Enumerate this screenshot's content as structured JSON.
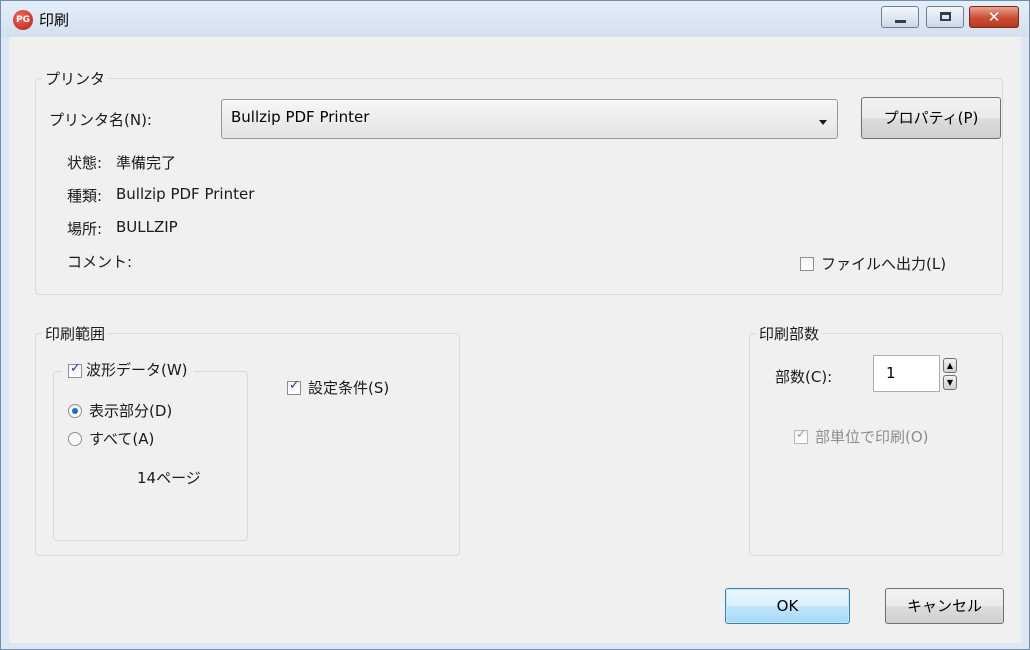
{
  "window": {
    "app_icon": "PG",
    "title": "印刷",
    "min_icon": "minimize-icon",
    "max_icon": "maximize-icon",
    "close_icon": "close-icon",
    "close_glyph": "✕"
  },
  "printer": {
    "legend": "プリンタ",
    "name_label": "プリンタ名(N):",
    "name_value": "Bullzip PDF Printer",
    "properties_button": "プロパティ(P)",
    "status_label": "状態:",
    "status_value": "準備完了",
    "type_label": "種類:",
    "type_value": "Bullzip PDF Printer",
    "location_label": "場所:",
    "location_value": "BULLZIP",
    "comment_label": "コメント:",
    "print_to_file": {
      "label": "ファイルへ出力(L)",
      "checked": false
    }
  },
  "range": {
    "legend": "印刷範囲",
    "waveform": {
      "label": "波形データ(W)",
      "checked": true
    },
    "display_part": {
      "label": "表示部分(D)",
      "selected": true
    },
    "all": {
      "label": "すべて(A)",
      "selected": false
    },
    "page_count": "14ページ",
    "settings": {
      "label": "設定条件(S)",
      "checked": true
    }
  },
  "copies": {
    "legend": "印刷部数",
    "count_label": "部数(C):",
    "count_value": "1",
    "up_icon": "spin-up-icon",
    "down_icon": "spin-down-icon",
    "collate": {
      "label": "部単位で印刷(O)",
      "checked": true,
      "enabled": false
    }
  },
  "buttons": {
    "ok": "OK",
    "cancel": "キャンセル"
  }
}
